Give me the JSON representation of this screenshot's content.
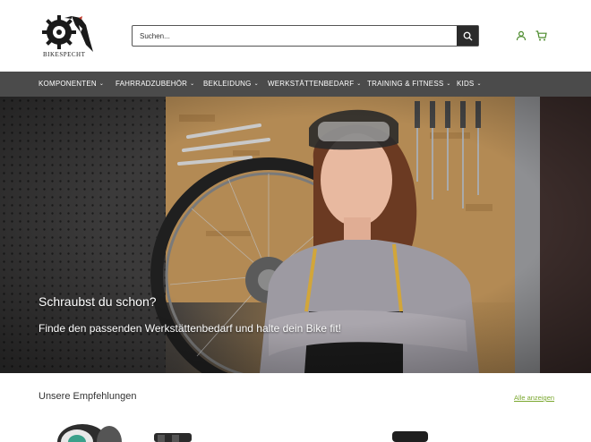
{
  "brand": {
    "name": "BIKESPECHT"
  },
  "search": {
    "placeholder": "Suchen..."
  },
  "icons": {
    "search": "search-icon",
    "account": "user-icon",
    "cart": "cart-icon",
    "dropdown": "chevron-down-icon"
  },
  "nav": {
    "items": [
      {
        "label": "KOMPONENTEN"
      },
      {
        "label": "FAHRRADZUBEHÖR"
      },
      {
        "label": "BEKLEIDUNG"
      },
      {
        "label": "WERKSTÄTTENBEDARF"
      },
      {
        "label": "TRAINING & FITNESS"
      },
      {
        "label": "KIDS"
      }
    ]
  },
  "hero": {
    "title": "Schraubst du schon?",
    "subtitle": "Finde den passenden Werkstättenbedarf und halte dein Bike fit!"
  },
  "recommendations": {
    "title": "Unsere Empfehlungen",
    "link": "Alle anzeigen"
  },
  "colors": {
    "nav_bg": "#4b4b4b",
    "accent_link": "#7aa72f",
    "search_button": "#2b2b2b"
  }
}
